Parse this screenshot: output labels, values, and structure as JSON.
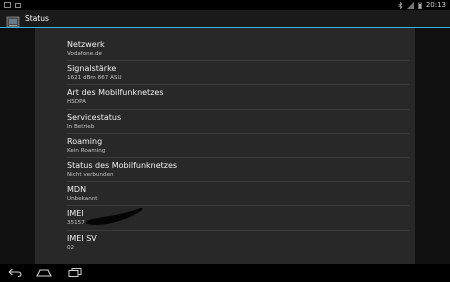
{
  "status_bar": {
    "time": "20:13",
    "icons": [
      "picture-icon",
      "email-icon",
      "bluetooth-icon",
      "signal-icon",
      "battery-icon"
    ]
  },
  "action_bar": {
    "title": "Status",
    "icon": "settings-app-icon"
  },
  "items": [
    {
      "title": "Netzwerk",
      "value": "Vodafone.de"
    },
    {
      "title": "Signalstärke",
      "value": "1621 dBm   867 ASU"
    },
    {
      "title": "Art des Mobilfunknetzes",
      "value": "HSDPA"
    },
    {
      "title": "Servicestatus",
      "value": "In Betrieb"
    },
    {
      "title": "Roaming",
      "value": "Kein Roaming"
    },
    {
      "title": "Status des Mobilfunknetzes",
      "value": "Nicht verbunden"
    },
    {
      "title": "MDN",
      "value": "Unbekannt"
    },
    {
      "title": "IMEI",
      "value": "35157"
    },
    {
      "title": "IMEI SV",
      "value": "02"
    }
  ],
  "nav_bar": {
    "buttons": [
      "back-icon",
      "home-icon",
      "recent-apps-icon"
    ]
  },
  "colors": {
    "accent": "#33b5e5",
    "panel": "#282828",
    "background": "#101010"
  }
}
